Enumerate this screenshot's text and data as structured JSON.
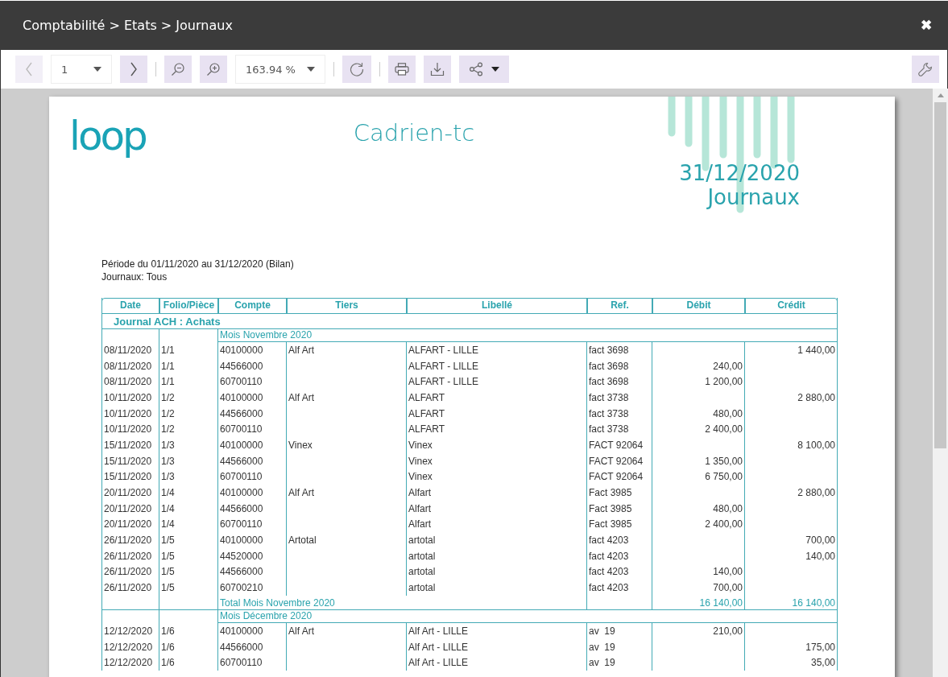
{
  "window": {
    "title": "Comptabilité > Etats > Journaux",
    "close": "✖"
  },
  "toolbar": {
    "prev": {
      "disabled": true
    },
    "page": "1",
    "next": {
      "disabled": false
    },
    "zoom": "163.94 %"
  },
  "report": {
    "logo": "loop",
    "company": "Cadrien-tc",
    "date": "31/12/2020",
    "name": "Journaux",
    "filters": [
      "Période du 01/11/2020 au 31/12/2020 (Bilan)",
      "Journaux: Tous"
    ],
    "columns": [
      "Date",
      "Folio/Pièce",
      "Compte",
      "Tiers",
      "Libellé",
      "Ref.",
      "Débit",
      "Crédit"
    ],
    "journal": "Journal ACH : Achats",
    "months": [
      {
        "label": "Mois Novembre 2020",
        "rows": [
          [
            "08/11/2020",
            "1/1",
            "40100000",
            "Alf Art",
            "ALFART - LILLE",
            "fact 3698",
            null,
            "1 440,00"
          ],
          [
            "08/11/2020",
            "1/1",
            "44566000",
            null,
            "ALFART - LILLE",
            "fact 3698",
            "240,00",
            null
          ],
          [
            "08/11/2020",
            "1/1",
            "60700110",
            null,
            "ALFART - LILLE",
            "fact 3698",
            "1 200,00",
            null
          ],
          [
            "10/11/2020",
            "1/2",
            "40100000",
            "Alf Art",
            "ALFART",
            "fact 3738",
            null,
            "2 880,00"
          ],
          [
            "10/11/2020",
            "1/2",
            "44566000",
            null,
            "ALFART",
            "fact 3738",
            "480,00",
            null
          ],
          [
            "10/11/2020",
            "1/2",
            "60700110",
            null,
            "ALFART",
            "fact 3738",
            "2 400,00",
            null
          ],
          [
            "15/11/2020",
            "1/3",
            "40100000",
            "Vinex",
            "Vinex",
            "FACT 92064",
            null,
            "8 100,00"
          ],
          [
            "15/11/2020",
            "1/3",
            "44566000",
            null,
            "Vinex",
            "FACT 92064",
            "1 350,00",
            null
          ],
          [
            "15/11/2020",
            "1/3",
            "60700110",
            null,
            "Vinex",
            "FACT 92064",
            "6 750,00",
            null
          ],
          [
            "20/11/2020",
            "1/4",
            "40100000",
            "Alf Art",
            "Alfart",
            "Fact 3985",
            null,
            "2 880,00"
          ],
          [
            "20/11/2020",
            "1/4",
            "44566000",
            null,
            "Alfart",
            "Fact 3985",
            "480,00",
            null
          ],
          [
            "20/11/2020",
            "1/4",
            "60700110",
            null,
            "Alfart",
            "Fact 3985",
            "2 400,00",
            null
          ],
          [
            "26/11/2020",
            "1/5",
            "40100000",
            "Artotal",
            "artotal",
            "fact 4203",
            null,
            "700,00"
          ],
          [
            "26/11/2020",
            "1/5",
            "44520000",
            null,
            "artotal",
            "fact 4203",
            null,
            "140,00"
          ],
          [
            "26/11/2020",
            "1/5",
            "44566000",
            null,
            "artotal",
            "fact 4203",
            "140,00",
            null
          ],
          [
            "26/11/2020",
            "1/5",
            "60700210",
            null,
            "artotal",
            "fact 4203",
            "700,00",
            null
          ]
        ],
        "total": {
          "label": "Total Mois Novembre 2020",
          "debit": "16 140,00",
          "credit": "16 140,00"
        }
      },
      {
        "label": "Mois Décembre 2020",
        "rows": [
          [
            "12/12/2020",
            "1/6",
            "40100000",
            "Alf Art",
            "Alf Art - LILLE",
            "av  19",
            "210,00",
            null
          ],
          [
            "12/12/2020",
            "1/6",
            "44566000",
            null,
            "Alf Art - LILLE",
            "av  19",
            null,
            "175,00"
          ],
          [
            "12/12/2020",
            "1/6",
            "60700110",
            null,
            "Alf Art - LILLE",
            "av  19",
            null,
            "35,00"
          ]
        ]
      }
    ]
  }
}
